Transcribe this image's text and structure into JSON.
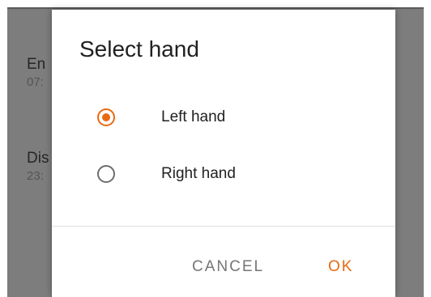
{
  "background": {
    "items": [
      {
        "title": "En",
        "subtitle": "07:"
      },
      {
        "title": "Dis",
        "subtitle": "23:"
      }
    ]
  },
  "dialog": {
    "title": "Select hand",
    "options": [
      {
        "label": "Left hand",
        "selected": true
      },
      {
        "label": "Right hand",
        "selected": false
      }
    ],
    "cancel_label": "CANCEL",
    "ok_label": "OK"
  },
  "colors": {
    "accent": "#e86a10",
    "scrim": "#7d7d7d"
  }
}
